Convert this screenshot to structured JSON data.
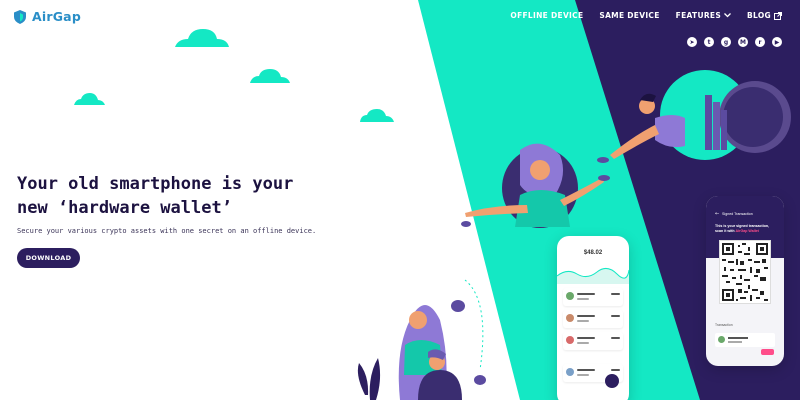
{
  "brand": {
    "name": "AirGap",
    "logo_icon": "shield-icon",
    "logo_color": "#2a8ec7"
  },
  "nav": {
    "items": [
      {
        "label": "OFFLINE DEVICE"
      },
      {
        "label": "SAME DEVICE"
      },
      {
        "label": "FEATURES",
        "icon": "chevron-down-icon"
      },
      {
        "label": "BLOG",
        "icon": "external-link-icon"
      }
    ]
  },
  "social": [
    {
      "icon": "telegram-icon",
      "glyph": "➤"
    },
    {
      "icon": "twitter-icon",
      "glyph": "t"
    },
    {
      "icon": "github-icon",
      "glyph": "g"
    },
    {
      "icon": "medium-icon",
      "glyph": "M"
    },
    {
      "icon": "reddit-icon",
      "glyph": "r"
    },
    {
      "icon": "youtube-icon",
      "glyph": "▶"
    }
  ],
  "hero": {
    "title_line1": "Your old smartphone is your",
    "title_line2": "new ‘hardware wallet’",
    "subtitle": "Secure your various crypto assets with one secret on an offline device.",
    "download_label": "DOWNLOAD"
  },
  "phones": {
    "left_amount": "$48.02",
    "right_title": "Signed Transaction",
    "right_text_1": "This is your signed transaction, scan it",
    "right_text_2": "with",
    "right_highlight": "AirGap Wallet",
    "right_caption": "Transaction"
  },
  "colors": {
    "teal": "#14e8c4",
    "purple": "#2c1e5f",
    "navy_text": "#1c1240",
    "accent_pink": "#ff4d8a"
  }
}
